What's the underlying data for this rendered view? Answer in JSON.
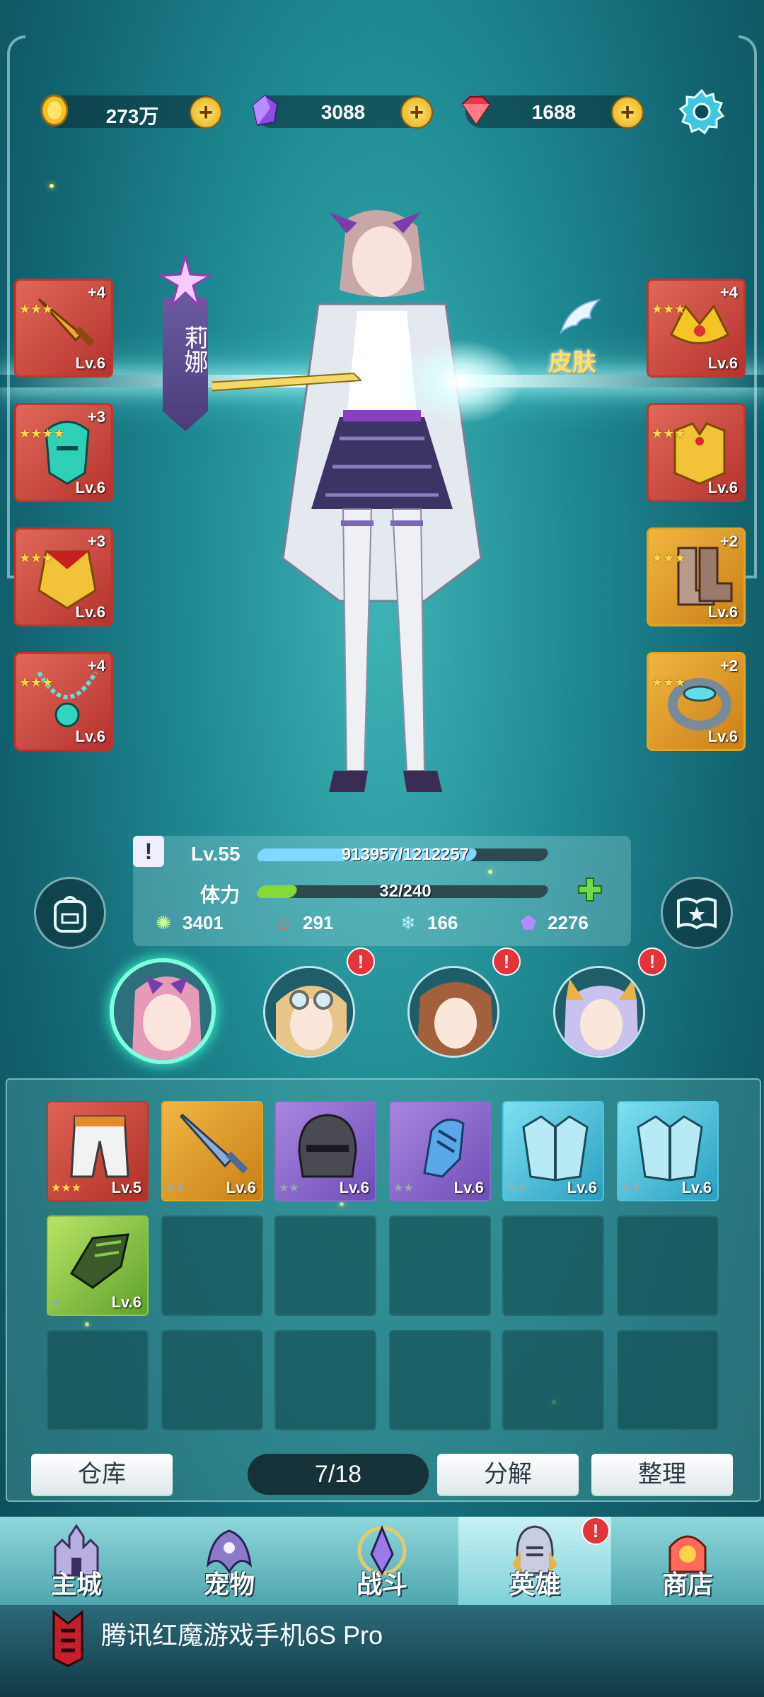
{
  "currency": {
    "gold": "273万",
    "crystal": "3088",
    "ruby": "1688",
    "add_symbol": "+"
  },
  "hero": {
    "name": "莉娜",
    "skin_label": "皮肤",
    "level_label": "Lv.55",
    "exp_text": "913957/1212257",
    "exp_fraction": 0.754,
    "stamina_label": "体力",
    "stamina_text": "32/240",
    "stamina_fraction": 0.133,
    "stats": [
      "3401",
      "291",
      "166",
      "2276"
    ],
    "notice": "!"
  },
  "equipment_left": [
    {
      "plus": "+4",
      "level": "Lv.6",
      "icon": "sword-icon"
    },
    {
      "plus": "+3",
      "level": "Lv.6",
      "icon": "helmet-icon"
    },
    {
      "plus": "+3",
      "level": "Lv.6",
      "icon": "armor-icon"
    },
    {
      "plus": "+4",
      "level": "Lv.6",
      "icon": "necklace-icon"
    }
  ],
  "equipment_right": [
    {
      "plus": "+4",
      "level": "Lv.6",
      "icon": "crown-icon"
    },
    {
      "plus": "",
      "level": "Lv.6",
      "icon": "chest-armor-icon"
    },
    {
      "plus": "+2",
      "level": "Lv.6",
      "icon": "boots-icon"
    },
    {
      "plus": "+2",
      "level": "Lv.6",
      "icon": "ring-icon"
    }
  ],
  "inventory": {
    "items": [
      {
        "level": "Lv.5",
        "rarity": "red",
        "icon": "pants-icon"
      },
      {
        "level": "Lv.6",
        "rarity": "gold",
        "icon": "greatsword-icon"
      },
      {
        "level": "Lv.6",
        "rarity": "purple",
        "icon": "iron-helmet-icon"
      },
      {
        "level": "Lv.6",
        "rarity": "purple",
        "icon": "gauntlet-icon"
      },
      {
        "level": "Lv.6",
        "rarity": "blue",
        "icon": "plate-armor-icon"
      },
      {
        "level": "Lv.6",
        "rarity": "blue",
        "icon": "plate-armor-icon"
      },
      {
        "level": "Lv.6",
        "rarity": "green",
        "icon": "glove-icon"
      }
    ],
    "count": "7/18",
    "warehouse_label": "仓库",
    "decompose_label": "分解",
    "sort_label": "整理"
  },
  "nav": [
    "主城",
    "宠物",
    "战斗",
    "英雄",
    "商店"
  ],
  "active_nav": "英雄",
  "brand_text": "腾讯红魔游戏手机6S Pro",
  "colors": {
    "red_rarity": "#c3342c",
    "gold_rarity": "#e2a423",
    "purple_rarity": "#8a6ad0",
    "blue_rarity": "#4cc4de",
    "green_rarity": "#8dc845",
    "exp_bar": "#7fd8ff",
    "stamina_bar": "#86d93a"
  }
}
